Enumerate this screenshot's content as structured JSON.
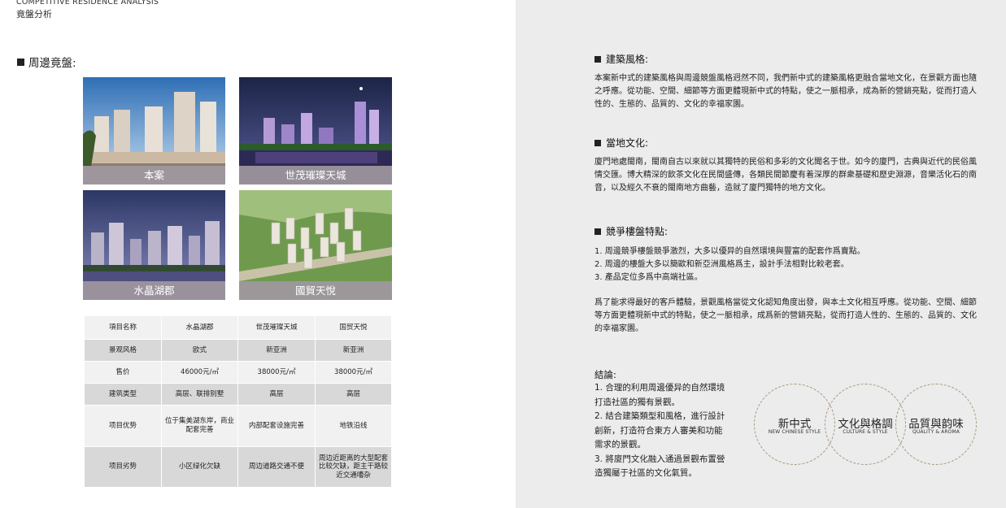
{
  "header": {
    "en": "COMPETITIVE  RESIDENCE ANALYSIS",
    "zh": "竟盤分析"
  },
  "left": {
    "section_title": "周邊竟盤:",
    "photos": [
      {
        "caption": "本案"
      },
      {
        "caption": "世茂璀璨天城"
      },
      {
        "caption": "水晶湖郡"
      },
      {
        "caption": "國貿天悅"
      }
    ],
    "table": {
      "headers": [
        "項目名称",
        "水晶湖郡",
        "世茂璀璨天城",
        "国贸天悦"
      ],
      "rows": [
        [
          "景观风格",
          "欧式",
          "新亚洲",
          "新亚洲"
        ],
        [
          "售价",
          "46000元/㎡",
          "38000元/㎡",
          "38000元/㎡"
        ],
        [
          "建筑类型",
          "高层、联排别墅",
          "高层",
          "高层"
        ],
        [
          "项目优势",
          "位于集美湖东岸，商业配套完善",
          "内部配套设施完善",
          "地铁沿线"
        ],
        [
          "项目劣势",
          "小区绿化欠缺",
          "周边道路交通不便",
          "周边近距离的大型配套比较欠缺，距主干路较近交通嘈杂"
        ]
      ]
    }
  },
  "right": {
    "sections": [
      {
        "title": "建築風格:",
        "body": "本案新中式的建築風格與周邊競盤風格迥然不同，我們新中式的建築風格更融合當地文化，在景觀方面也隨之呼應。從功能、空間、細節等方面更體現新中式的特點，使之一脈相承，成為新的營銷亮點，從而打造人性的、生態的、品質的、文化的幸福家園。"
      },
      {
        "title": "當地文化:",
        "body": "廈門地處閩南，閩南自古以來就以其獨特的民俗和多彩的文化聞名于世。如今的廈門，古典與近代的民俗風情交匯。博大精深的飲茶文化在民間盛傳，各類民間節慶有着深厚的群衆基礎和歷史淵源，音樂活化石的南音，以及經久不衰的閩南地方曲藝，造就了廈門獨特的地方文化。"
      },
      {
        "title": "競爭樓盤特點:",
        "items": [
          "1. 周邊競爭樓盤競爭激烈，大多以優异的自然環境與豐富的配套作爲賣點。",
          "2. 周邊的樓盤大多以簡歐和新亞洲風格爲主，設計手法相對比較老套。",
          "3. 產品定位多爲中高端社區。"
        ],
        "body": "爲了能求得最好的客戶體驗，景觀風格當從文化認知角度出發，與本土文化相互呼應。從功能、空間、細節等方面更體現新中式的特點，使之一脈相承，成爲新的營銷亮點，從而打造人性的、生態的、品質的、文化的幸福家園。"
      }
    ],
    "conclusion": {
      "title": "結論:",
      "items": [
        "1. 合理的利用周邊優异的自然環境打造社區的獨有景觀。",
        "2. 結合建築類型和風格，進行設計創新，打造符合東方人審美和功能需求的景觀。",
        "3. 將廈門文化融入通過景觀布置營造獨屬于社區的文化氣質。"
      ]
    },
    "circles": [
      {
        "zh": "新中式",
        "en": "NEW CHINESE STYLE"
      },
      {
        "zh": "文化與格調",
        "en": "CULTURE & STYLE"
      },
      {
        "zh": "品質與韵味",
        "en": "QUALITY & AROMA"
      }
    ]
  }
}
